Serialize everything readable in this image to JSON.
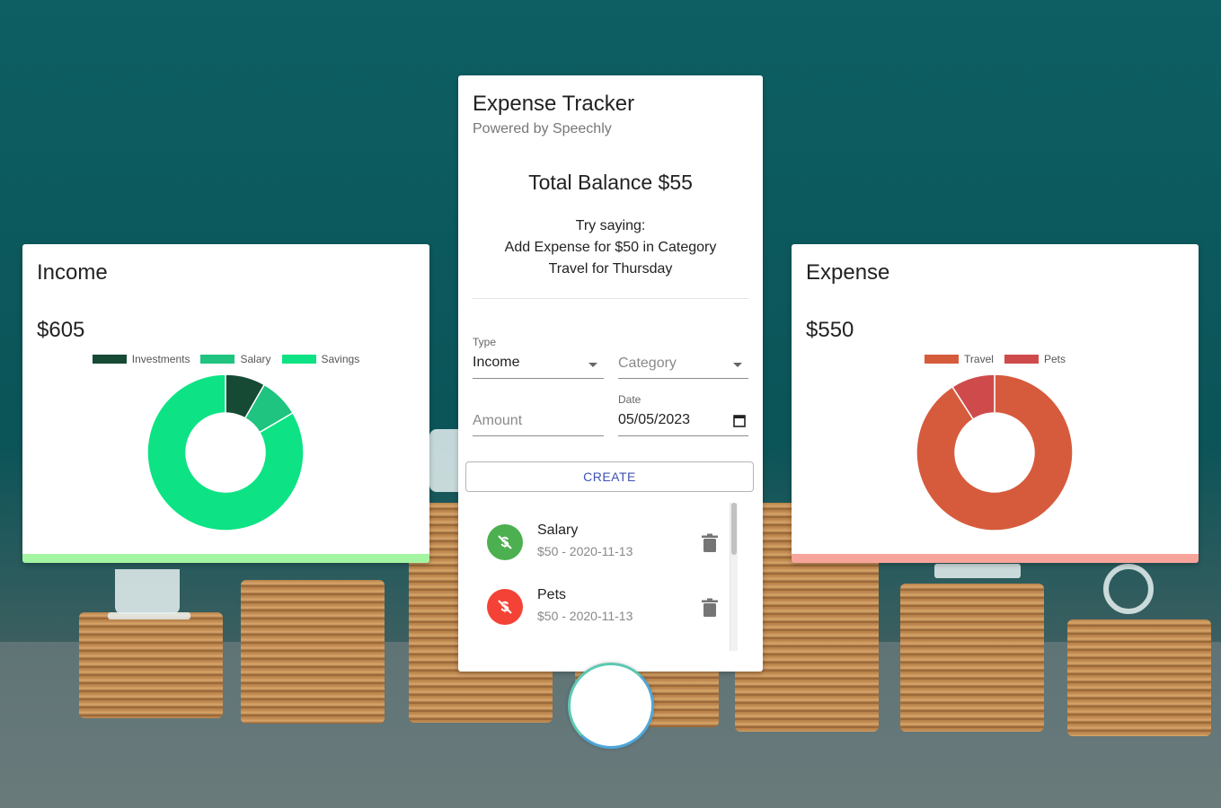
{
  "income": {
    "title": "Income",
    "amount": "$605",
    "border_color": "#a4f5a1",
    "chart_data": {
      "type": "pie",
      "categories": [
        "Investments",
        "Salary",
        "Savings"
      ],
      "values": [
        50,
        50,
        505
      ],
      "colors": [
        "#164a34",
        "#1ec47f",
        "#0de384"
      ],
      "legend": "top"
    }
  },
  "expense": {
    "title": "Expense",
    "amount": "$550",
    "border_color": "#f7a49b",
    "chart_data": {
      "type": "pie",
      "categories": [
        "Travel",
        "Pets"
      ],
      "values": [
        500,
        50
      ],
      "colors": [
        "#d65b3c",
        "#cf4b4b"
      ],
      "legend": "top"
    }
  },
  "main": {
    "title": "Expense Tracker",
    "subtitle": "Powered by Speechly",
    "balance": "Total Balance $55",
    "hint_line1": "Try saying:",
    "hint_line2": "Add Expense for $50 in Category",
    "hint_line3": "Travel for Thursday",
    "form": {
      "type_label": "Type",
      "type_value": "Income",
      "category_placeholder": "Category",
      "amount_placeholder": "Amount",
      "date_label": "Date",
      "date_value": "05/05/2023",
      "create_label": "CREATE"
    },
    "transactions": [
      {
        "name": "Salary",
        "detail": "$50 - 2020-11-13",
        "kind": "income",
        "color": "#4caf50"
      },
      {
        "name": "Pets",
        "detail": "$50 - 2020-11-13",
        "kind": "expense",
        "color": "#f44336"
      }
    ]
  }
}
